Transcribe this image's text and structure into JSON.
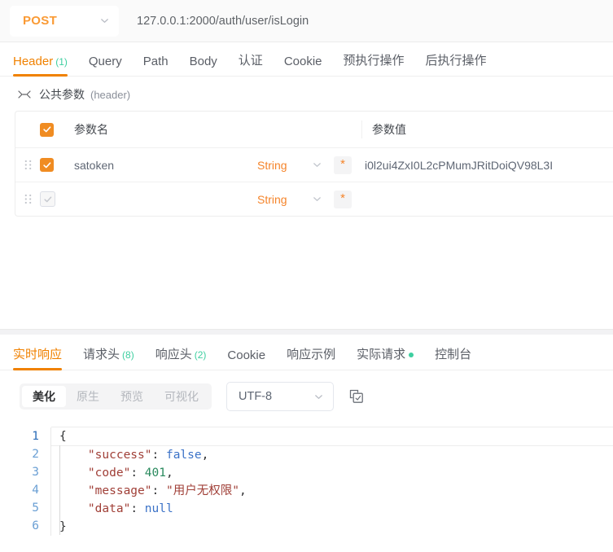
{
  "urlbar": {
    "method": "POST",
    "method_chevron_icon": "chevron-down-icon",
    "url": "127.0.0.1:2000/auth/user/isLogin"
  },
  "request_tabs": [
    {
      "label": "Header",
      "count": "(1)",
      "active": true
    },
    {
      "label": "Query",
      "count": "",
      "active": false
    },
    {
      "label": "Path",
      "count": "",
      "active": false
    },
    {
      "label": "Body",
      "count": "",
      "active": false
    },
    {
      "label": "认证",
      "count": "",
      "active": false
    },
    {
      "label": "Cookie",
      "count": "",
      "active": false
    },
    {
      "label": "预执行操作",
      "count": "",
      "active": false
    },
    {
      "label": "后执行操作",
      "count": "",
      "active": false
    }
  ],
  "public_params": {
    "collapse_icon": "collapse-arrows-icon",
    "title": "公共参数",
    "subtitle": "(header)"
  },
  "param_table": {
    "headers": {
      "name": "参数名",
      "value": "参数值"
    },
    "rows": [
      {
        "checked": true,
        "name": "satoken",
        "type": "String",
        "required_icon": "asterisk-icon",
        "value": "i0l2ui4ZxI0L2cPMumJRitDoiQV98L3I"
      },
      {
        "checked": false,
        "name": "",
        "type": "String",
        "required_icon": "asterisk-icon",
        "value": ""
      }
    ]
  },
  "response_tabs": [
    {
      "label": "实时响应",
      "count": "",
      "dot": false,
      "active": true
    },
    {
      "label": "请求头",
      "count": "(8)",
      "dot": false,
      "active": false
    },
    {
      "label": "响应头",
      "count": "(2)",
      "dot": false,
      "active": false
    },
    {
      "label": "Cookie",
      "count": "",
      "dot": false,
      "active": false
    },
    {
      "label": "响应示例",
      "count": "",
      "dot": false,
      "active": false
    },
    {
      "label": "实际请求",
      "count": "",
      "dot": true,
      "active": false
    },
    {
      "label": "控制台",
      "count": "",
      "dot": false,
      "active": false
    }
  ],
  "view_modes": [
    {
      "label": "美化",
      "active": true
    },
    {
      "label": "原生",
      "active": false
    },
    {
      "label": "预览",
      "active": false
    },
    {
      "label": "可视化",
      "active": false
    }
  ],
  "encoding": {
    "value": "UTF-8",
    "chevron_icon": "chevron-down-icon"
  },
  "copy_icon": "copy-icon",
  "response_body": {
    "line_numbers": [
      "1",
      "2",
      "3",
      "4",
      "5",
      "6"
    ],
    "lines": [
      {
        "n": "1",
        "raw": "{"
      },
      {
        "n": "2",
        "raw": "    \"success\": false,"
      },
      {
        "n": "3",
        "raw": "    \"code\": 401,"
      },
      {
        "n": "4",
        "raw": "    \"message\": \"用户无权限\","
      },
      {
        "n": "5",
        "raw": "    \"data\": null"
      },
      {
        "n": "6",
        "raw": "}"
      }
    ],
    "json": {
      "success": "false",
      "code": "401",
      "message": "用户无权限",
      "data": "null"
    }
  },
  "colors": {
    "accent_orange": "#f08100",
    "count_green": "#3ecfa0",
    "checkbox_orange": "#f08c22",
    "type_orange": "#f5842a"
  }
}
